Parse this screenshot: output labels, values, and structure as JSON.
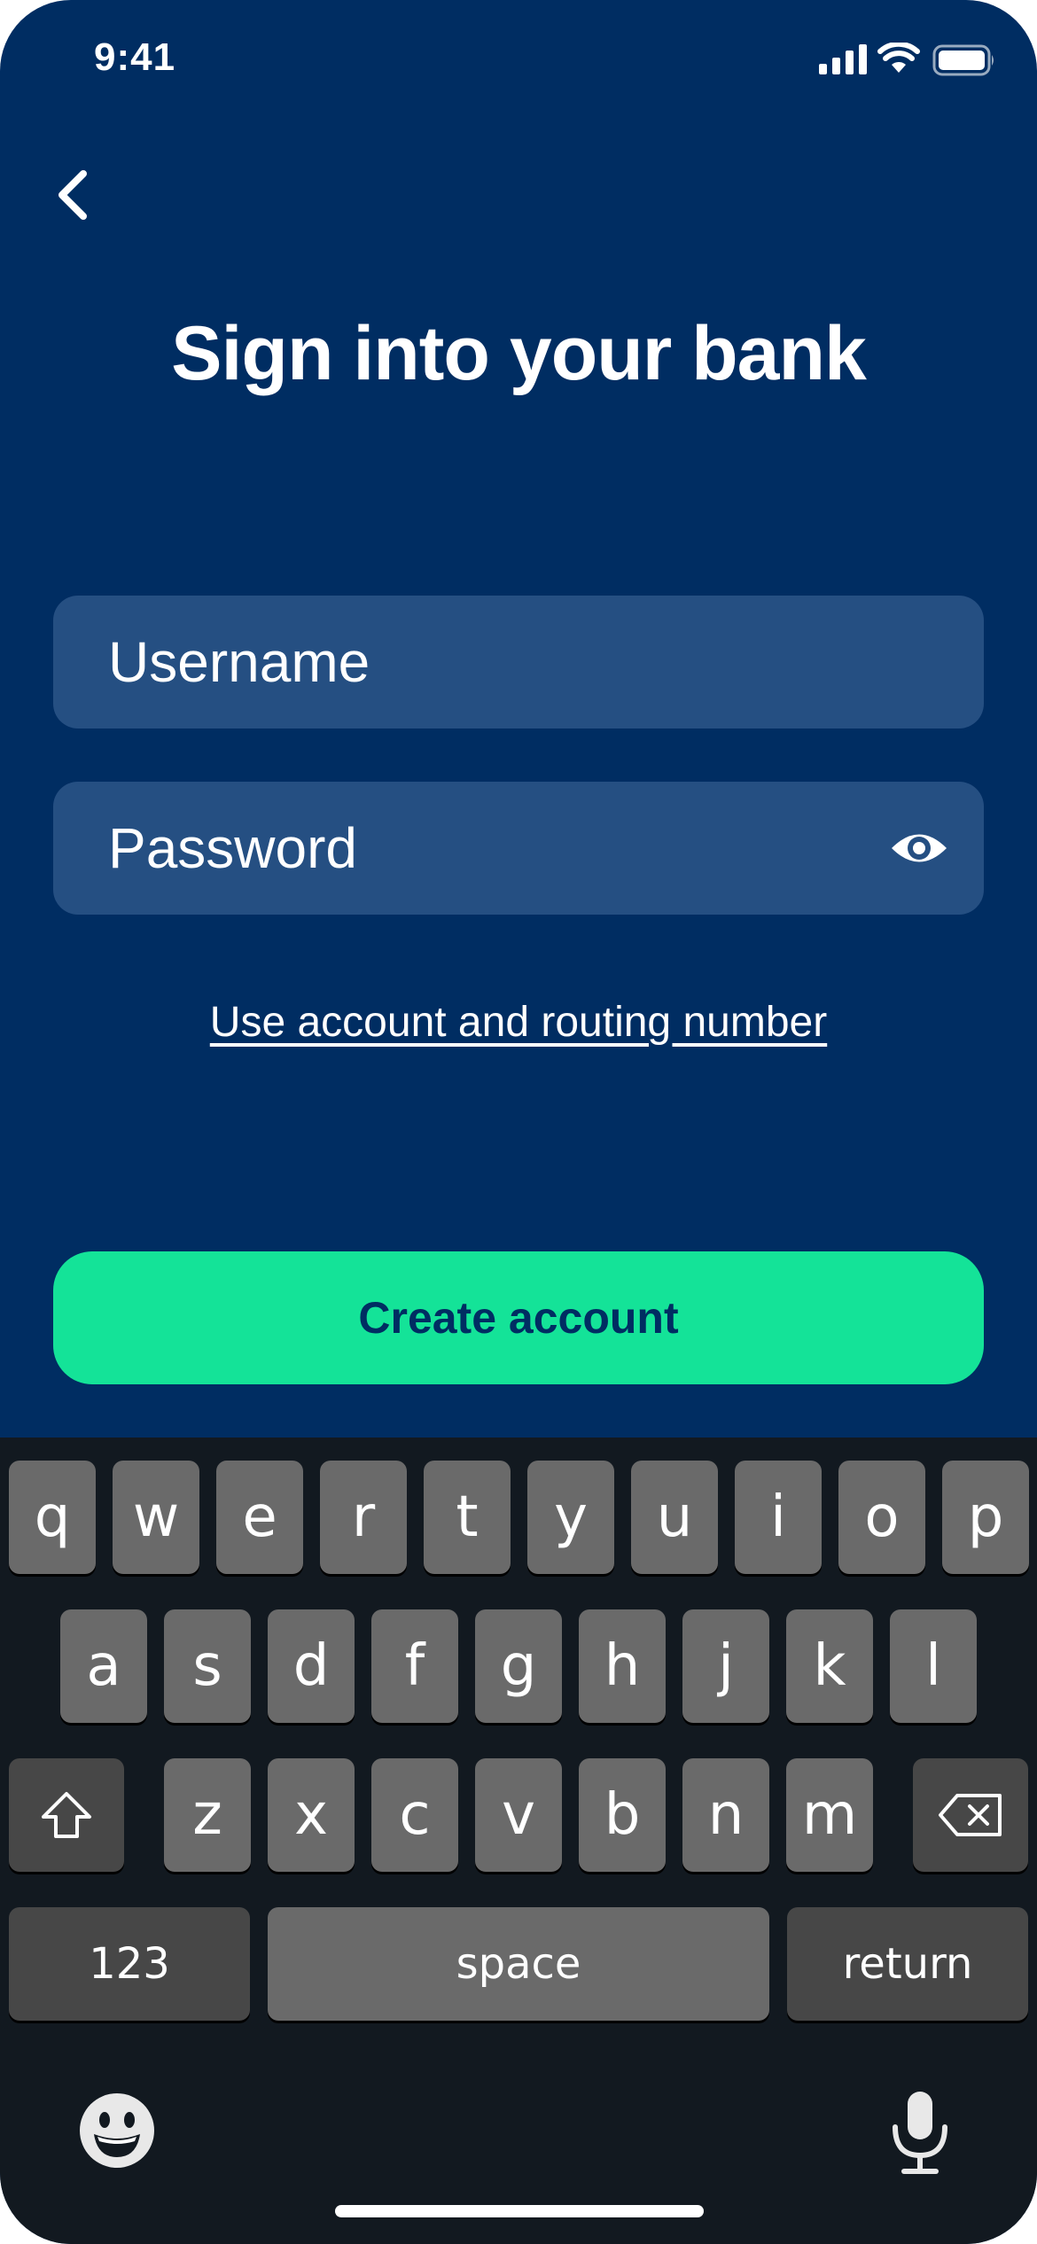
{
  "status_bar": {
    "time": "9:41",
    "signal_icon": "cellular-signal-icon",
    "wifi_icon": "wifi-icon",
    "battery_icon": "battery-icon"
  },
  "header": {
    "back_icon": "chevron-left-icon",
    "title": "Sign into your bank"
  },
  "form": {
    "username": {
      "value": "",
      "placeholder": "Username"
    },
    "password": {
      "value": "",
      "placeholder": "Password",
      "toggle_icon": "eye-icon"
    },
    "routing_link": "Use account and routing number",
    "create_button": "Create account"
  },
  "keyboard": {
    "row1": [
      "q",
      "w",
      "e",
      "r",
      "t",
      "y",
      "u",
      "i",
      "o",
      "p"
    ],
    "row2": [
      "a",
      "s",
      "d",
      "f",
      "g",
      "h",
      "j",
      "k",
      "l"
    ],
    "row3": [
      "z",
      "x",
      "c",
      "v",
      "b",
      "n",
      "m"
    ],
    "shift_icon": "shift-icon",
    "delete_icon": "backspace-icon",
    "numbers_label": "123",
    "space_label": "space",
    "return_label": "return",
    "emoji_icon": "emoji-icon",
    "mic_icon": "microphone-icon"
  },
  "colors": {
    "background": "#002D62",
    "field_background": "#254F82",
    "accent_button": "#14E398",
    "keyboard_background": "#121920",
    "key_light": "#6A6A6A",
    "key_dark": "#474747"
  }
}
